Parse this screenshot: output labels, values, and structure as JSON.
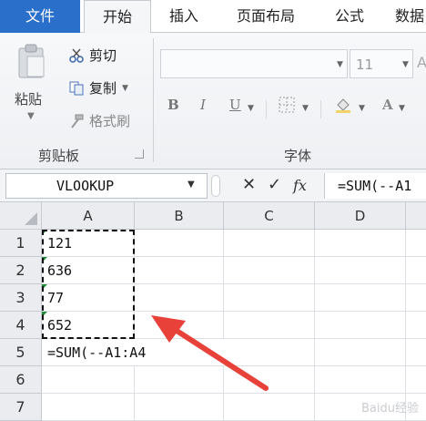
{
  "tabs": {
    "file": "文件",
    "home": "开始",
    "insert": "插入",
    "page_layout": "页面布局",
    "formulas": "公式",
    "data": "数据"
  },
  "clipboard": {
    "paste": "粘贴",
    "cut": "剪切",
    "copy": "复制",
    "format_painter": "格式刷",
    "group_label": "剪贴板"
  },
  "font": {
    "size": "11",
    "bold": "B",
    "italic": "I",
    "underline": "U",
    "group_label": "字体"
  },
  "formula_bar": {
    "name_box": "VLOOKUP",
    "cancel": "✕",
    "enter": "✓",
    "fx": "fx",
    "formula": "=SUM(--A1"
  },
  "grid": {
    "columns": [
      "A",
      "B",
      "C",
      "D"
    ],
    "rows": [
      "1",
      "2",
      "3",
      "4",
      "5",
      "6",
      "7"
    ],
    "cells": {
      "A1": "121",
      "A2": "636",
      "A3": "77",
      "A4": "652",
      "A5": "=SUM(--A1:A4"
    }
  },
  "watermark": "Baidu经验",
  "colors": {
    "file_tab": "#2a6fc9",
    "arrow": "#e8413a",
    "text_number_indicator": "#1e8a3a"
  },
  "icons": [
    "clipboard-icon",
    "scissors-icon",
    "copy-icon",
    "format-painter-icon",
    "border-icon",
    "fill-color-icon",
    "font-color-icon",
    "corner-triangle-icon",
    "red-arrow-icon"
  ]
}
